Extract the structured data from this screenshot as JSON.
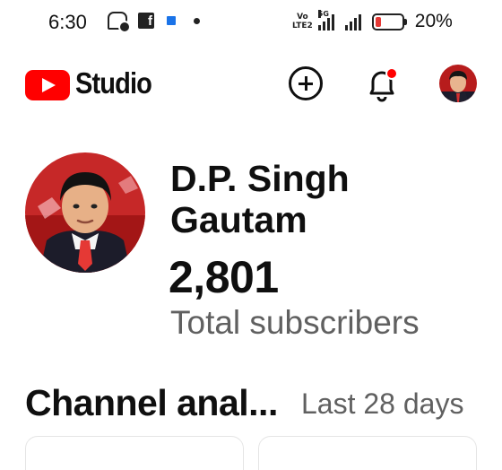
{
  "status_bar": {
    "time": "6:30",
    "volte_top": "Vo",
    "volte_bottom": "LTE2",
    "network": "5G",
    "battery_percent": "20%",
    "battery_level": 0.2,
    "battery_color": "#e53935"
  },
  "app_bar": {
    "brand": "Studio",
    "brand_color": "#ff0000",
    "create_icon": "plus-circle-icon",
    "notifications_icon": "bell-icon",
    "has_notification_badge": true
  },
  "channel": {
    "name": "D.P. Singh Gautam",
    "subscriber_count": "2,801",
    "subscriber_label": "Total subscribers"
  },
  "analytics": {
    "title": "Channel anal...",
    "range": "Last 28 days"
  }
}
